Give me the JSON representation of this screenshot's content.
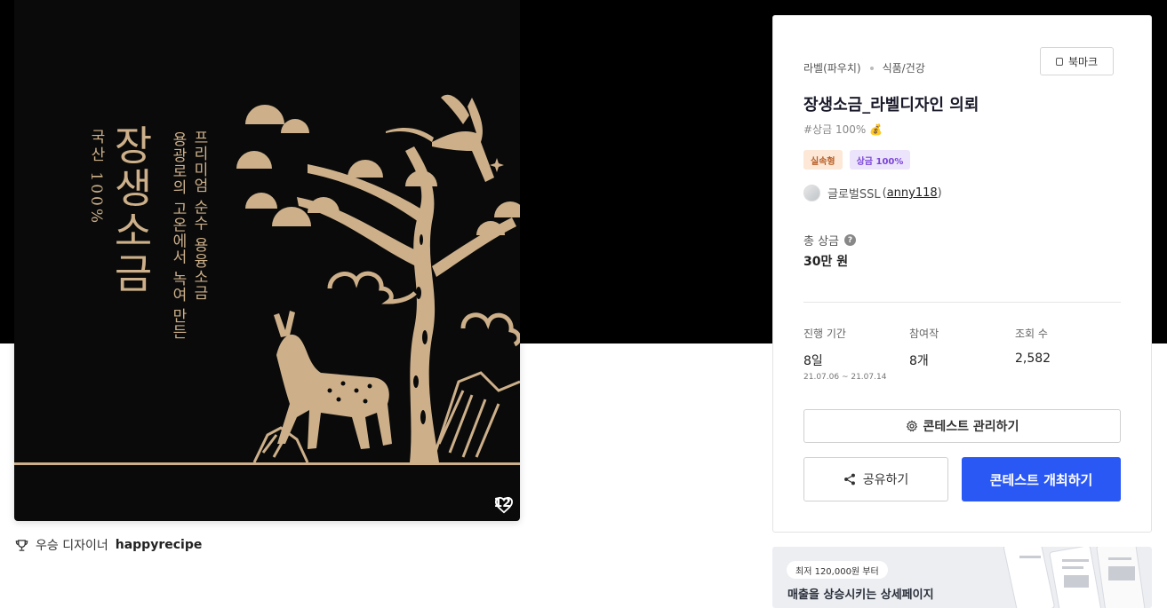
{
  "artwork": {
    "vertical_small": "국산 100%",
    "vertical_big": "장생소금",
    "vertical_sub2": "용광로의 고온에서 녹여 만든",
    "vertical_sub1": "프리미엄 순수 용융소금",
    "likes": "12"
  },
  "winner": {
    "prefix": "우승 디자이너",
    "name": "happyrecipe"
  },
  "panel": {
    "category_1": "라벨(파우치)",
    "category_2": "식품/건강",
    "bookmark_label": "북마크",
    "title": "장생소금_라벨디자인 의뢰",
    "hashtag": "#상금 100% 💰",
    "badge_1": "실속형",
    "badge_2": "상금 100%",
    "host_name": "글로벌SSL",
    "host_id": "anny118",
    "prize_label": "총 상금",
    "prize_value": "30만 원",
    "stats": [
      {
        "label": "진행 기간",
        "value": "8일",
        "sub": "21.07.06 ~ 21.07.14"
      },
      {
        "label": "참여작",
        "value": "8개",
        "sub": ""
      },
      {
        "label": "조회 수",
        "value": "2,582",
        "sub": ""
      }
    ],
    "manage_label": "콘테스트 관리하기",
    "share_label": "공유하기",
    "host_button_label": "콘테스트 개최하기"
  },
  "ad": {
    "pill": "최저 120,000원 부터",
    "title": "매출을 상승시키는 상세페이지"
  },
  "colors": {
    "gold": "#cdb08a",
    "primary": "#2a58f5",
    "hero_bg": "#000000"
  },
  "icons": [
    "bookmark-icon",
    "heart-icon",
    "trophy-icon",
    "question-icon",
    "gear-icon",
    "share-icon"
  ]
}
